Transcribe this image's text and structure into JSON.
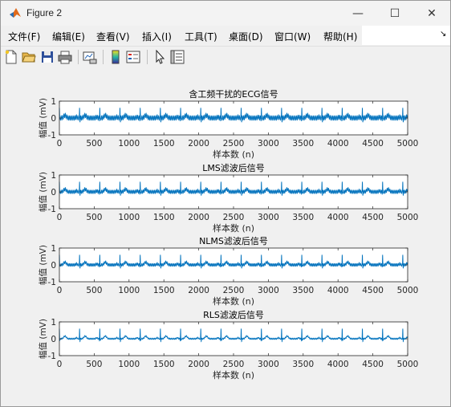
{
  "window": {
    "title": "Figure 2",
    "minimize_glyph": "—",
    "maximize_glyph": "☐",
    "close_glyph": "✕"
  },
  "menu": {
    "items": [
      "文件(F)",
      "编辑(E)",
      "查看(V)",
      "插入(I)",
      "工具(T)",
      "桌面(D)",
      "窗口(W)",
      "帮助(H)"
    ],
    "overflow_glyph": "↘"
  },
  "toolbar": {
    "icons": [
      "new-figure-icon",
      "open-file-icon",
      "save-icon",
      "print-icon",
      "link-plot-icon",
      "colorbar-icon",
      "legend-icon",
      "pointer-icon",
      "property-inspector-icon"
    ]
  },
  "colors": {
    "line": "#0072bd",
    "axes_bg": "#ffffff",
    "figure_bg": "#f0f0f0"
  },
  "chart_data": [
    {
      "type": "line",
      "title": "含工频干扰的ECG信号",
      "xlabel": "样本数 (n)",
      "ylabel": "幅值 (mV)",
      "xlim": [
        0,
        5000
      ],
      "ylim": [
        -1,
        1
      ],
      "xticks": [
        "0",
        "500",
        "1000",
        "1500",
        "2000",
        "2500",
        "3000",
        "3500",
        "4000",
        "4500",
        "5000"
      ],
      "yticks": [
        "-1",
        "0",
        "1"
      ],
      "interference": 0.13,
      "r_peak_amplitude": 0.62,
      "beat_period_samples": 290,
      "first_r_peak": 290
    },
    {
      "type": "line",
      "title": "LMS滤波后信号",
      "xlabel": "样本数 (n)",
      "ylabel": "幅值 (mV)",
      "xlim": [
        0,
        5000
      ],
      "ylim": [
        -1,
        1
      ],
      "xticks": [
        "0",
        "500",
        "1000",
        "1500",
        "2000",
        "2500",
        "3000",
        "3500",
        "4000",
        "4500",
        "5000"
      ],
      "yticks": [
        "-1",
        "0",
        "1"
      ],
      "interference": 0.1,
      "r_peak_amplitude": 0.62,
      "beat_period_samples": 290,
      "first_r_peak": 290
    },
    {
      "type": "line",
      "title": "NLMS滤波后信号",
      "xlabel": "样本数 (n)",
      "ylabel": "幅值 (mV)",
      "xlim": [
        0,
        5000
      ],
      "ylim": [
        -1,
        1
      ],
      "xticks": [
        "0",
        "500",
        "1000",
        "1500",
        "2000",
        "2500",
        "3000",
        "3500",
        "4000",
        "4500",
        "5000"
      ],
      "yticks": [
        "-1",
        "0",
        "1"
      ],
      "interference": 0.08,
      "r_peak_amplitude": 0.62,
      "beat_period_samples": 290,
      "first_r_peak": 290
    },
    {
      "type": "line",
      "title": "RLS滤波后信号",
      "xlabel": "样本数 (n)",
      "ylabel": "幅值 (mV)",
      "xlim": [
        0,
        5000
      ],
      "ylim": [
        -1,
        1
      ],
      "xticks": [
        "0",
        "500",
        "1000",
        "1500",
        "2000",
        "2500",
        "3000",
        "3500",
        "4000",
        "4500",
        "5000"
      ],
      "yticks": [
        "-1",
        "0",
        "1"
      ],
      "interference": 0.04,
      "r_peak_amplitude": 0.62,
      "beat_period_samples": 290,
      "first_r_peak": 290
    }
  ]
}
